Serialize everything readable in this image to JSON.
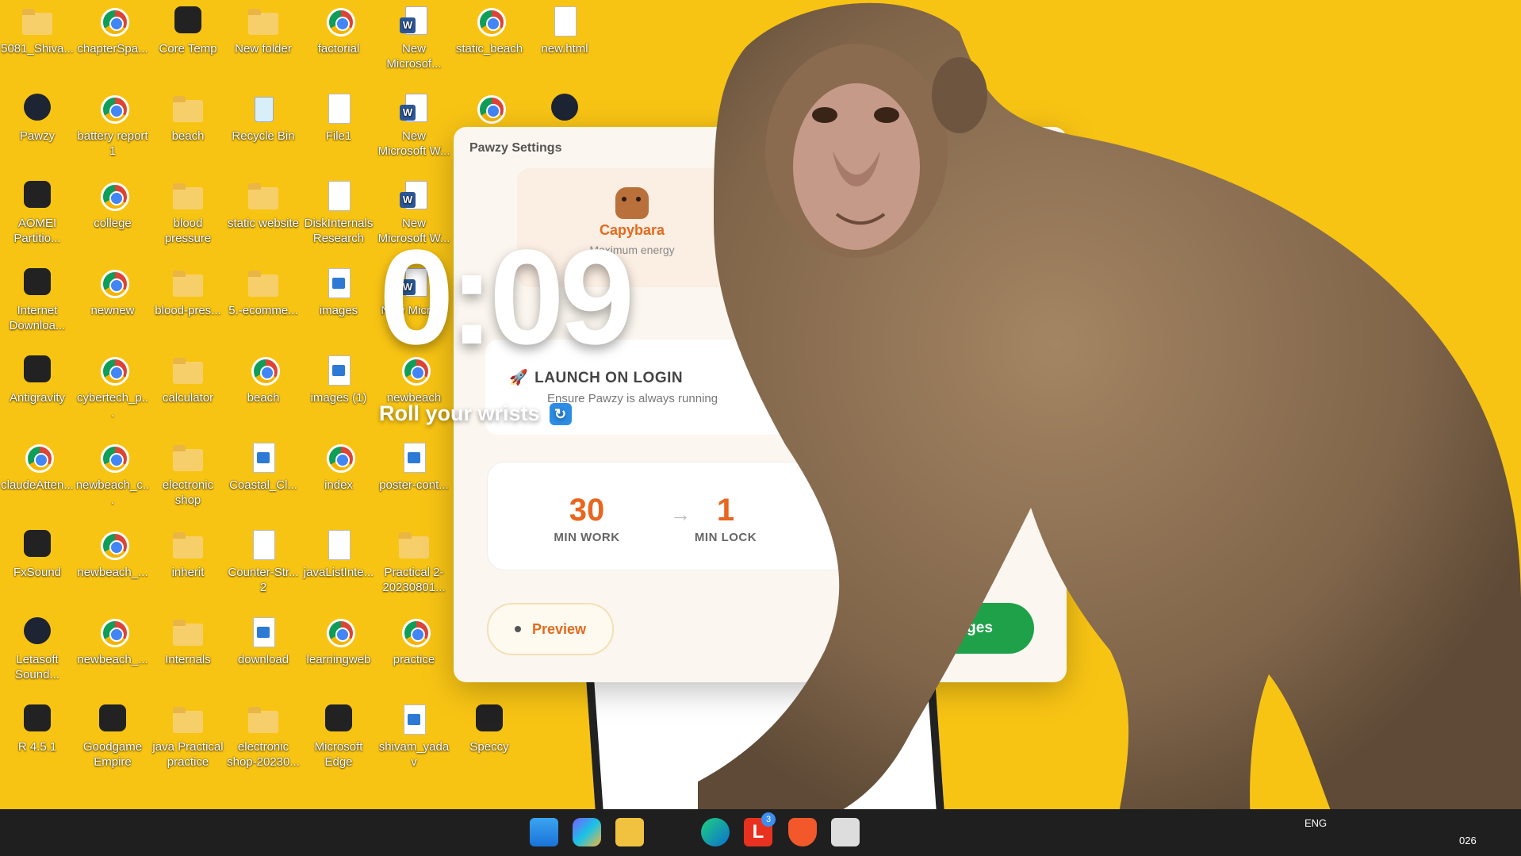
{
  "desktop_icons": [
    {
      "label": "5081_Shiva...",
      "type": "folder"
    },
    {
      "label": "chapterSpa...",
      "type": "chrome"
    },
    {
      "label": "Core Temp",
      "type": "app"
    },
    {
      "label": "New folder",
      "type": "folder"
    },
    {
      "label": "factorial",
      "type": "chrome"
    },
    {
      "label": "New Microsof...",
      "type": "word"
    },
    {
      "label": "static_beach",
      "type": "chrome"
    },
    {
      "label": "new.html",
      "type": "file"
    },
    {
      "label": "Pawzy",
      "type": "round"
    },
    {
      "label": "battery report 1",
      "type": "chrome"
    },
    {
      "label": "beach",
      "type": "folder"
    },
    {
      "label": "Recycle Bin",
      "type": "bin"
    },
    {
      "label": "File1",
      "type": "file"
    },
    {
      "label": "New Microsoft W...",
      "type": "word"
    },
    {
      "label": "",
      "type": "chrome"
    },
    {
      "label": "",
      "type": "round"
    },
    {
      "label": "AOMEI Partitio...",
      "type": "app"
    },
    {
      "label": "college",
      "type": "chrome"
    },
    {
      "label": "blood pressure",
      "type": "folder"
    },
    {
      "label": "static website",
      "type": "folder"
    },
    {
      "label": "DiskInternals Research",
      "type": "file"
    },
    {
      "label": "New Microsoft W...",
      "type": "word"
    },
    {
      "label": "Internet Downloa...",
      "type": "app"
    },
    {
      "label": "newnew",
      "type": "chrome"
    },
    {
      "label": "blood-pres...",
      "type": "folder"
    },
    {
      "label": "5.-ecomme...",
      "type": "folder"
    },
    {
      "label": "images",
      "type": "image"
    },
    {
      "label": "New Micro...",
      "type": "word"
    },
    {
      "label": "Antigravity",
      "type": "app"
    },
    {
      "label": "cybertech_p...",
      "type": "chrome"
    },
    {
      "label": "calculator",
      "type": "folder"
    },
    {
      "label": "beach",
      "type": "chrome"
    },
    {
      "label": "images (1)",
      "type": "image"
    },
    {
      "label": "newbeach",
      "type": "chrome"
    },
    {
      "label": "claudeAtten...",
      "type": "chrome"
    },
    {
      "label": "newbeach_c...",
      "type": "chrome"
    },
    {
      "label": "electronic shop",
      "type": "folder"
    },
    {
      "label": "Coastal_Cl...",
      "type": "image"
    },
    {
      "label": "index",
      "type": "chrome"
    },
    {
      "label": "poster-cont...",
      "type": "image"
    },
    {
      "label": "FxSound",
      "type": "app"
    },
    {
      "label": "newbeach_...",
      "type": "chrome"
    },
    {
      "label": "inherit",
      "type": "folder"
    },
    {
      "label": "Counter-Str... 2",
      "type": "file"
    },
    {
      "label": "javaListInte...",
      "type": "file"
    },
    {
      "label": "Practical 2-20230801...",
      "type": "folder"
    },
    {
      "label": "Letasoft Sound...",
      "type": "round"
    },
    {
      "label": "newbeach_...",
      "type": "chrome"
    },
    {
      "label": "Internals",
      "type": "folder"
    },
    {
      "label": "download",
      "type": "image"
    },
    {
      "label": "learningweb",
      "type": "chrome"
    },
    {
      "label": "practice",
      "type": "chrome"
    },
    {
      "label": "R 4.5.1",
      "type": "app"
    },
    {
      "label": "Goodgame Empire",
      "type": "app"
    },
    {
      "label": "java Practical practice",
      "type": "folder"
    },
    {
      "label": "electronic shop-20230...",
      "type": "folder"
    },
    {
      "label": "Microsoft Edge",
      "type": "app"
    },
    {
      "label": "shivam_yadav",
      "type": "image"
    },
    {
      "label": "Speccy",
      "type": "app"
    }
  ],
  "settings": {
    "title": "Pawzy Settings",
    "pet_name": "Capybara",
    "pet_desc": "Maximum energy",
    "launch_icon": "rocket-icon",
    "launch_title": "LAUNCH ON LOGIN",
    "launch_sub": "Ensure Pawzy is always running",
    "work_value": "30",
    "work_label": "MIN WORK",
    "arrow": "→",
    "lock_value": "1",
    "lock_label": "MIN LOCK",
    "preview_label": "Preview",
    "save_label": "Save Changes"
  },
  "overlay": {
    "timer": "0:09",
    "hint": "Roll your wrists",
    "hint_icon": "↻"
  },
  "taskbar": {
    "badge": "3",
    "lapp_label": "L",
    "lang": "ENG",
    "time": "026"
  },
  "colors": {
    "desktop_bg": "#f8c414",
    "accent_orange": "#e36a1e",
    "save_green": "#1fa14a"
  }
}
